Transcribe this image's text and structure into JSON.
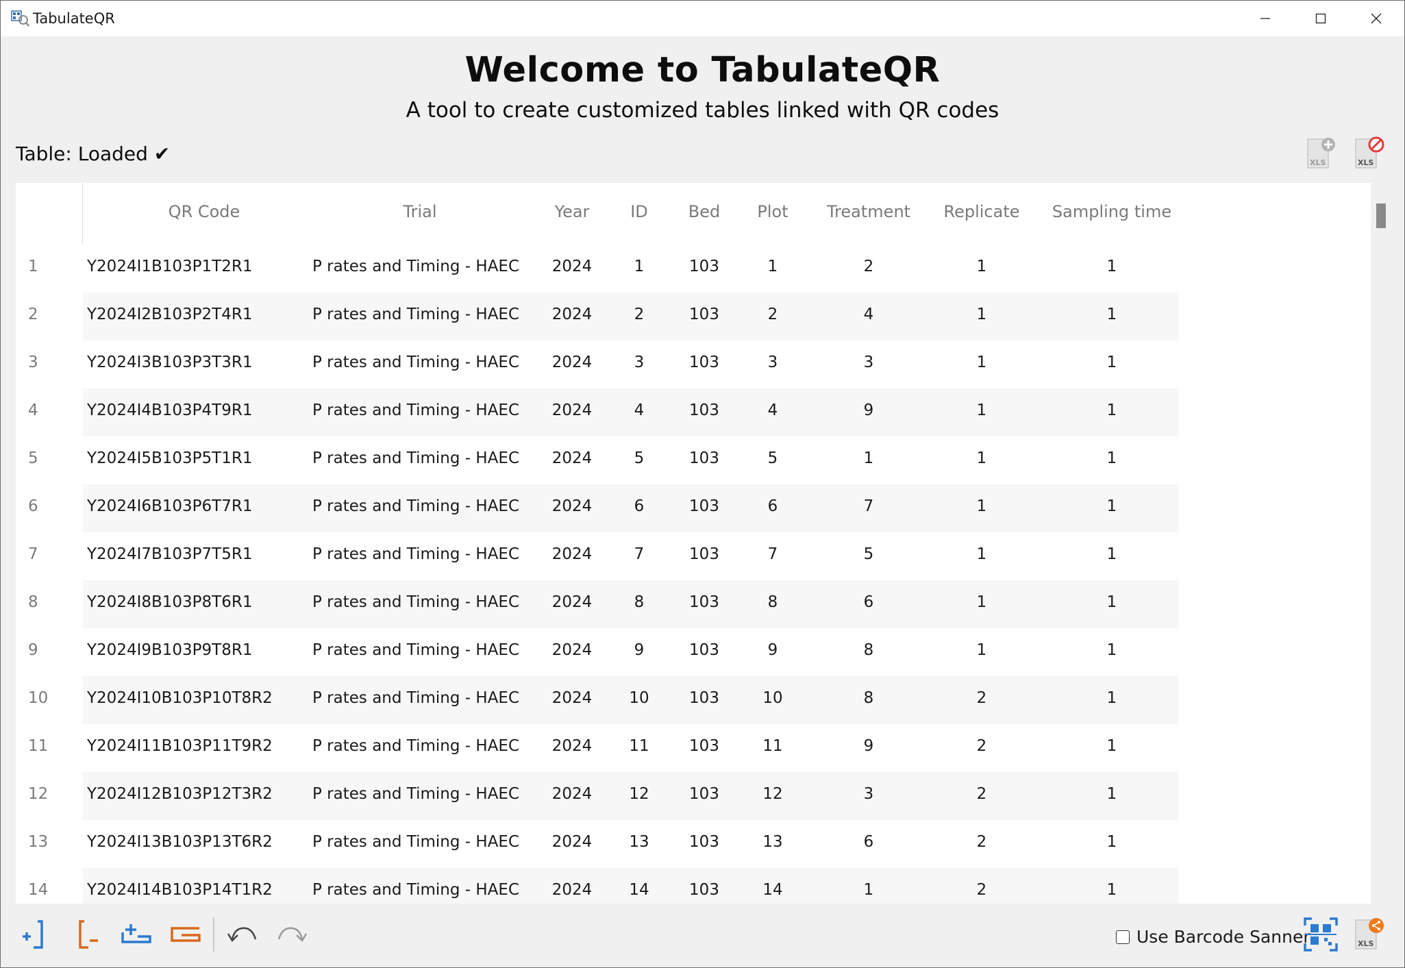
{
  "window": {
    "title": "TabulateQR"
  },
  "header": {
    "title": "Welcome to TabulateQR",
    "subtitle": "A tool to create customized tables linked with QR codes"
  },
  "status": {
    "text": "Table: Loaded ✔"
  },
  "toolbar_top": {
    "icons": [
      "add-xls-icon",
      "remove-xls-icon"
    ],
    "xls_label": "XLS"
  },
  "table": {
    "columns": [
      "QR Code",
      "Trial",
      "Year",
      "ID",
      "Bed",
      "Plot",
      "Treatment",
      "Replicate",
      "Sampling time"
    ],
    "rows": [
      {
        "n": "1",
        "qr": "Y2024I1B103P1T2R1",
        "trial": "P rates and Timing - HAEC",
        "year": "2024",
        "id": "1",
        "bed": "103",
        "plot": "1",
        "treatment": "2",
        "replicate": "1",
        "sampling": "1"
      },
      {
        "n": "2",
        "qr": "Y2024I2B103P2T4R1",
        "trial": "P rates and Timing - HAEC",
        "year": "2024",
        "id": "2",
        "bed": "103",
        "plot": "2",
        "treatment": "4",
        "replicate": "1",
        "sampling": "1"
      },
      {
        "n": "3",
        "qr": "Y2024I3B103P3T3R1",
        "trial": "P rates and Timing - HAEC",
        "year": "2024",
        "id": "3",
        "bed": "103",
        "plot": "3",
        "treatment": "3",
        "replicate": "1",
        "sampling": "1"
      },
      {
        "n": "4",
        "qr": "Y2024I4B103P4T9R1",
        "trial": "P rates and Timing - HAEC",
        "year": "2024",
        "id": "4",
        "bed": "103",
        "plot": "4",
        "treatment": "9",
        "replicate": "1",
        "sampling": "1"
      },
      {
        "n": "5",
        "qr": "Y2024I5B103P5T1R1",
        "trial": "P rates and Timing - HAEC",
        "year": "2024",
        "id": "5",
        "bed": "103",
        "plot": "5",
        "treatment": "1",
        "replicate": "1",
        "sampling": "1"
      },
      {
        "n": "6",
        "qr": "Y2024I6B103P6T7R1",
        "trial": "P rates and Timing - HAEC",
        "year": "2024",
        "id": "6",
        "bed": "103",
        "plot": "6",
        "treatment": "7",
        "replicate": "1",
        "sampling": "1"
      },
      {
        "n": "7",
        "qr": "Y2024I7B103P7T5R1",
        "trial": "P rates and Timing - HAEC",
        "year": "2024",
        "id": "7",
        "bed": "103",
        "plot": "7",
        "treatment": "5",
        "replicate": "1",
        "sampling": "1"
      },
      {
        "n": "8",
        "qr": "Y2024I8B103P8T6R1",
        "trial": "P rates and Timing - HAEC",
        "year": "2024",
        "id": "8",
        "bed": "103",
        "plot": "8",
        "treatment": "6",
        "replicate": "1",
        "sampling": "1"
      },
      {
        "n": "9",
        "qr": "Y2024I9B103P9T8R1",
        "trial": "P rates and Timing - HAEC",
        "year": "2024",
        "id": "9",
        "bed": "103",
        "plot": "9",
        "treatment": "8",
        "replicate": "1",
        "sampling": "1"
      },
      {
        "n": "10",
        "qr": "Y2024I10B103P10T8R2",
        "trial": "P rates and Timing - HAEC",
        "year": "2024",
        "id": "10",
        "bed": "103",
        "plot": "10",
        "treatment": "8",
        "replicate": "2",
        "sampling": "1"
      },
      {
        "n": "11",
        "qr": "Y2024I11B103P11T9R2",
        "trial": "P rates and Timing - HAEC",
        "year": "2024",
        "id": "11",
        "bed": "103",
        "plot": "11",
        "treatment": "9",
        "replicate": "2",
        "sampling": "1"
      },
      {
        "n": "12",
        "qr": "Y2024I12B103P12T3R2",
        "trial": "P rates and Timing - HAEC",
        "year": "2024",
        "id": "12",
        "bed": "103",
        "plot": "12",
        "treatment": "3",
        "replicate": "2",
        "sampling": "1"
      },
      {
        "n": "13",
        "qr": "Y2024I13B103P13T6R2",
        "trial": "P rates and Timing - HAEC",
        "year": "2024",
        "id": "13",
        "bed": "103",
        "plot": "13",
        "treatment": "6",
        "replicate": "2",
        "sampling": "1"
      },
      {
        "n": "14",
        "qr": "Y2024I14B103P14T1R2",
        "trial": "P rates and Timing - HAEC",
        "year": "2024",
        "id": "14",
        "bed": "103",
        "plot": "14",
        "treatment": "1",
        "replicate": "2",
        "sampling": "1"
      }
    ]
  },
  "toolbar_bottom": {
    "icons": [
      "insert-column-icon",
      "delete-column-icon",
      "insert-row-icon",
      "delete-row-icon",
      "undo-icon",
      "redo-icon"
    ],
    "scanner_label": "Use Barcode Sanner",
    "scanner_checked": false,
    "right_icons": [
      "qr-scan-icon",
      "export-xls-icon"
    ],
    "xls_label": "XLS"
  },
  "colors": {
    "accent_blue": "#2b7bd0",
    "accent_orange": "#d8691c",
    "red": "#e23a3a"
  }
}
